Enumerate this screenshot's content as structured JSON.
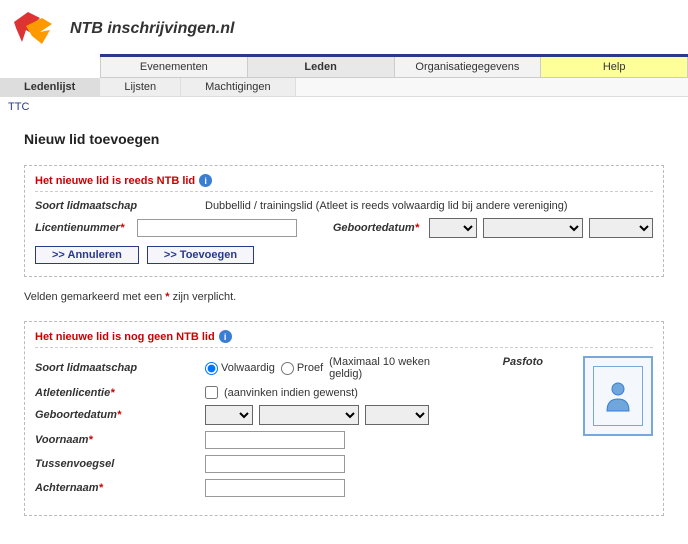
{
  "header": {
    "site_title": "NTB inschrijvingen.nl"
  },
  "main_nav": {
    "items": [
      "Evenementen",
      "Leden",
      "Organisatiegegevens",
      "Help"
    ],
    "active": 1
  },
  "sub_nav": {
    "items": [
      "Ledenlijst",
      "Lijsten",
      "Machtigingen"
    ],
    "active": 0
  },
  "breadcrumb": "TTC",
  "page_title": "Nieuw lid toevoegen",
  "section1": {
    "title": "Het nieuwe lid is reeds NTB lid",
    "soort_label": "Soort lidmaatschap",
    "soort_value": "Dubbellid / trainingslid (Atleet is reeds volwaardig lid bij andere vereniging)",
    "lic_label": "Licentienummer",
    "geb_label": "Geboortedatum",
    "btn_cancel": ">> Annuleren",
    "btn_add": ">> Toevoegen"
  },
  "note_prefix": "Velden gemarkeerd met een ",
  "note_marker": "*",
  "note_suffix": " zijn verplicht.",
  "section2": {
    "title": "Het nieuwe lid is nog geen NTB lid",
    "soort_label": "Soort lidmaatschap",
    "radio_volwaardig": "Volwaardig",
    "radio_proef": "Proef",
    "proef_hint": "(Maximaal 10 weken geldig)",
    "atleten_label": "Atletenlicentie",
    "atleten_hint": "(aanvinken indien gewenst)",
    "geb_label": "Geboortedatum",
    "voornaam_label": "Voornaam",
    "tussen_label": "Tussenvoegsel",
    "achternaam_label": "Achternaam",
    "pasfoto_label": "Pasfoto"
  }
}
